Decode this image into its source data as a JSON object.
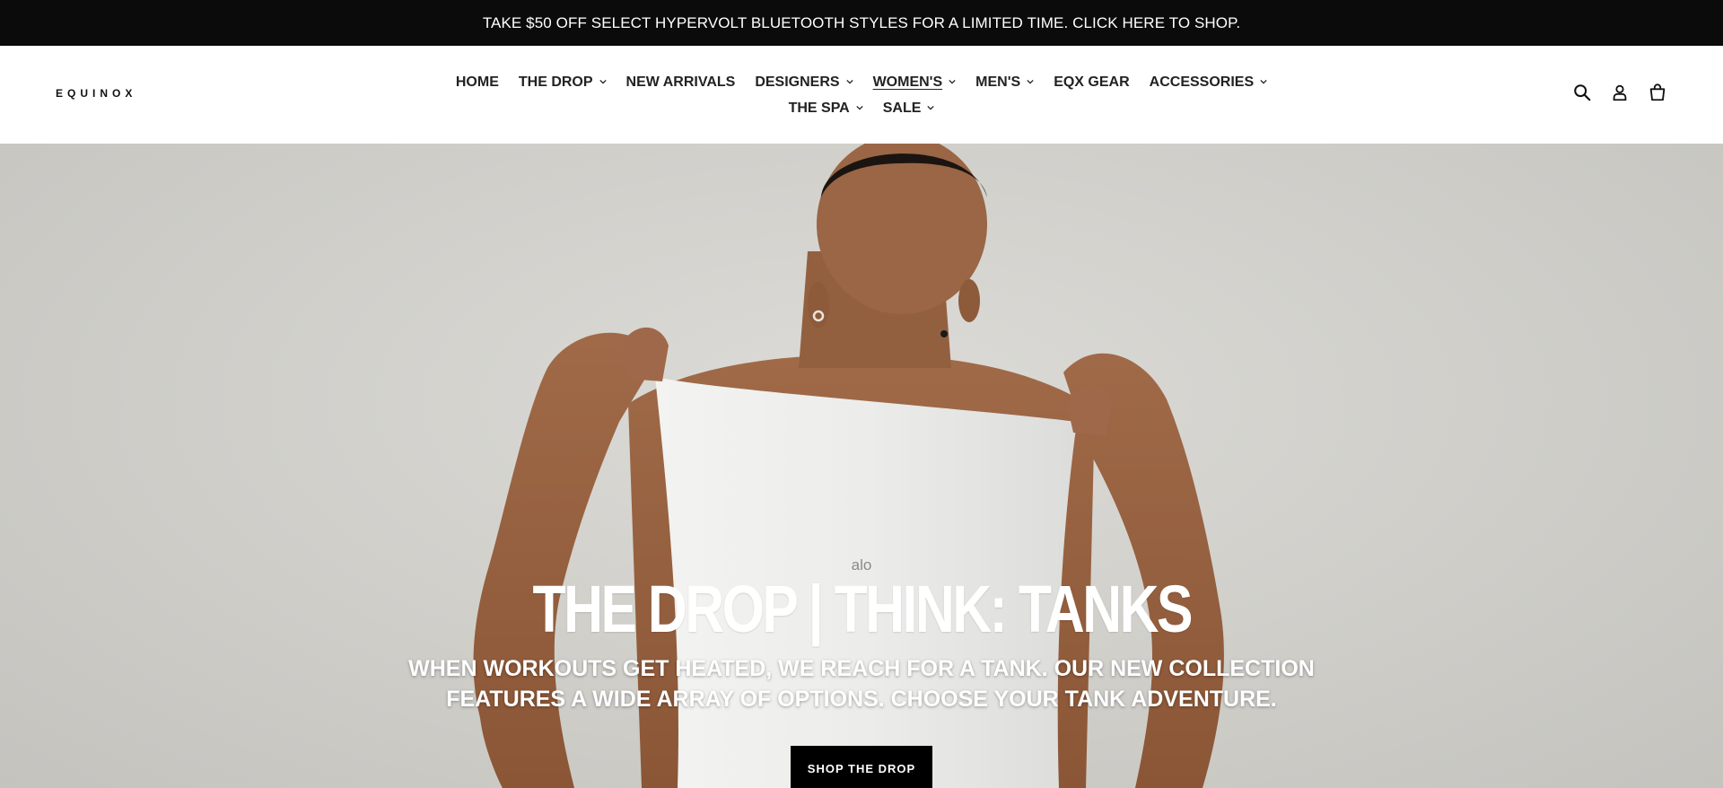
{
  "announcement": {
    "text": "TAKE $50 OFF SELECT HYPERVOLT BLUETOOTH STYLES FOR A LIMITED TIME. CLICK HERE TO SHOP."
  },
  "header": {
    "logo": "EQUINOX",
    "nav_row1": [
      {
        "label": "HOME",
        "dropdown": false
      },
      {
        "label": "THE DROP",
        "dropdown": true
      },
      {
        "label": "NEW ARRIVALS",
        "dropdown": false
      },
      {
        "label": "DESIGNERS",
        "dropdown": true
      },
      {
        "label": "WOMEN'S",
        "dropdown": true,
        "active": true
      },
      {
        "label": "MEN'S",
        "dropdown": true
      },
      {
        "label": "EQX GEAR",
        "dropdown": false
      },
      {
        "label": "ACCESSORIES",
        "dropdown": true
      }
    ],
    "nav_row2": [
      {
        "label": "THE SPA",
        "dropdown": true
      },
      {
        "label": "SALE",
        "dropdown": true
      }
    ],
    "icons": [
      "search-icon",
      "account-icon",
      "cart-icon"
    ]
  },
  "hero": {
    "brand_mark": "alo",
    "title": "THE DROP | THINK: TANKS",
    "subtitle": "WHEN WORKOUTS GET HEATED, WE REACH FOR A TANK. OUR NEW COLLECTION FEATURES A WIDE ARRAY OF OPTIONS. CHOOSE YOUR TANK ADVENTURE.",
    "cta_label": "SHOP THE DROP"
  },
  "colors": {
    "announcement_bg": "#0b0b0b",
    "hero_bg": "#cfcec9",
    "cta_bg": "#000000",
    "text_white": "#ffffff"
  }
}
